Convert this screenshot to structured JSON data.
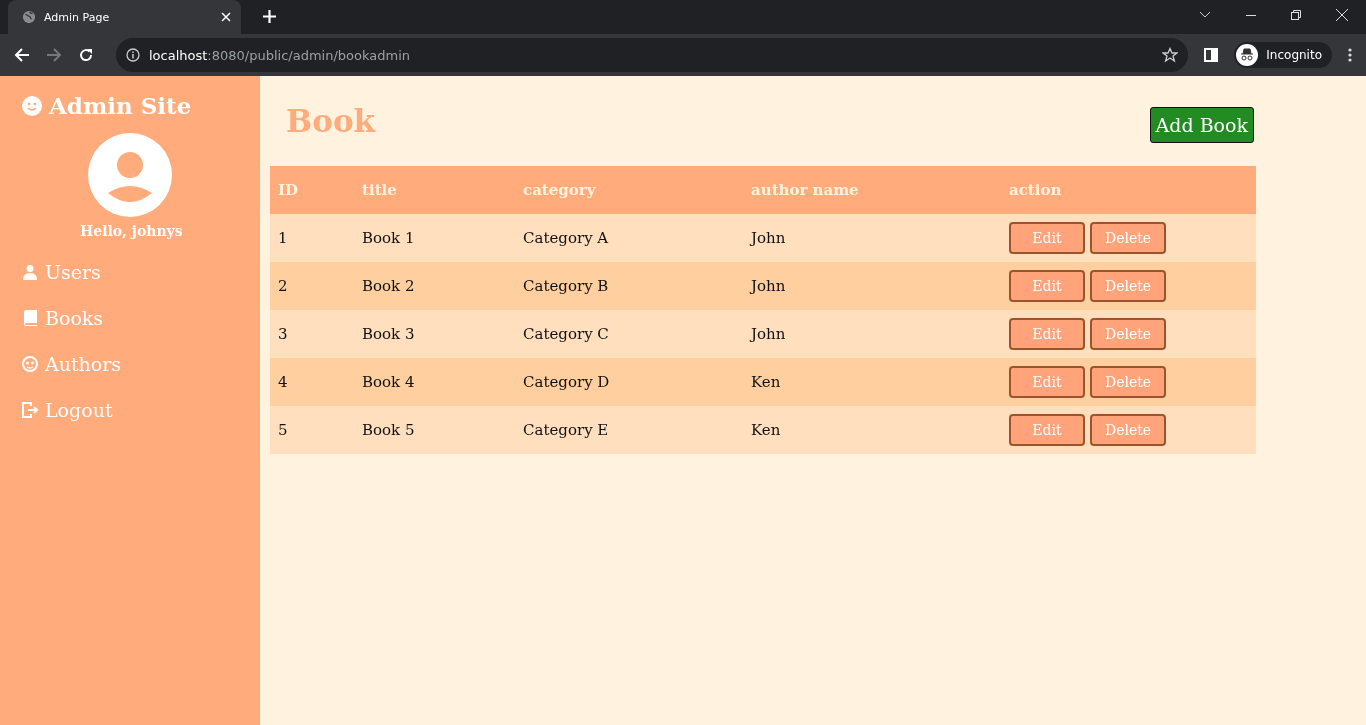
{
  "browser": {
    "tab_title": "Admin Page",
    "url_host": "localhost",
    "url_path": ":8080/public/admin/bookadmin",
    "profile_label": "Incognito"
  },
  "sidebar": {
    "title": "Admin Site",
    "greeting": "Hello, johnys",
    "items": [
      {
        "label": "Users"
      },
      {
        "label": "Books"
      },
      {
        "label": "Authors"
      },
      {
        "label": "Logout"
      }
    ]
  },
  "page": {
    "heading": "Book",
    "add_button": "Add Book"
  },
  "table": {
    "columns": [
      "ID",
      "title",
      "category",
      "author name",
      "action"
    ],
    "rows": [
      {
        "cells": [
          "1",
          "Book 1",
          "Category A",
          "John"
        ],
        "actions": [
          "Edit",
          "Delete"
        ]
      },
      {
        "cells": [
          "2",
          "Book 2",
          "Category B",
          "John"
        ],
        "actions": [
          "Edit",
          "Delete"
        ]
      },
      {
        "cells": [
          "3",
          "Book 3",
          "Category C",
          "John"
        ],
        "actions": [
          "Edit",
          "Delete"
        ]
      },
      {
        "cells": [
          "4",
          "Book 4",
          "Category D",
          "Ken"
        ],
        "actions": [
          "Edit",
          "Delete"
        ]
      },
      {
        "cells": [
          "5",
          "Book 5",
          "Category E",
          "Ken"
        ],
        "actions": [
          "Edit",
          "Delete"
        ]
      }
    ]
  }
}
